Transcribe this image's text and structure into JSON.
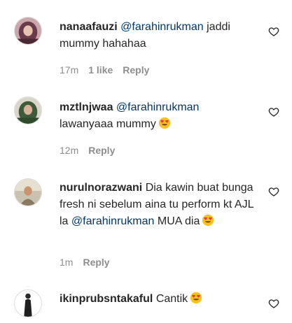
{
  "comments": [
    {
      "username": "nanaafauzi",
      "mention": "@farahinrukman",
      "text_after": "jaddi mummy hahahaa",
      "time": "17m",
      "likes": "1 like",
      "reply": "Reply",
      "avatar_icon": "avatar-woman-hijab-pink",
      "liked": false
    },
    {
      "username": "mztlnjwaa",
      "mention": "@farahinrukman",
      "text_after": "lawanyaaa mummy",
      "time": "12m",
      "reply": "Reply",
      "avatar_icon": "avatar-woman-hijab-green",
      "liked": false
    },
    {
      "username": "nurulnorazwani",
      "text_before": "Dia kawin buat bunga fresh ni sebelum aina tu perform kt AJL la",
      "mention": "@farahinrukman",
      "text_after": "MUA dia",
      "time": "1m",
      "reply": "Reply",
      "avatar_icon": "avatar-woman-outdoor",
      "liked": false
    },
    {
      "username": "ikinprubsntakaful",
      "text_after": "Cantik",
      "avatar_icon": "avatar-woman-standing",
      "liked": false
    }
  ],
  "icons": {
    "emoji": "smiling-face-heart-eyes-emoji",
    "like": "heart-outline-icon"
  },
  "colors": {
    "mention": "#00376b",
    "meta": "#8e8e8e",
    "text": "#262626"
  }
}
